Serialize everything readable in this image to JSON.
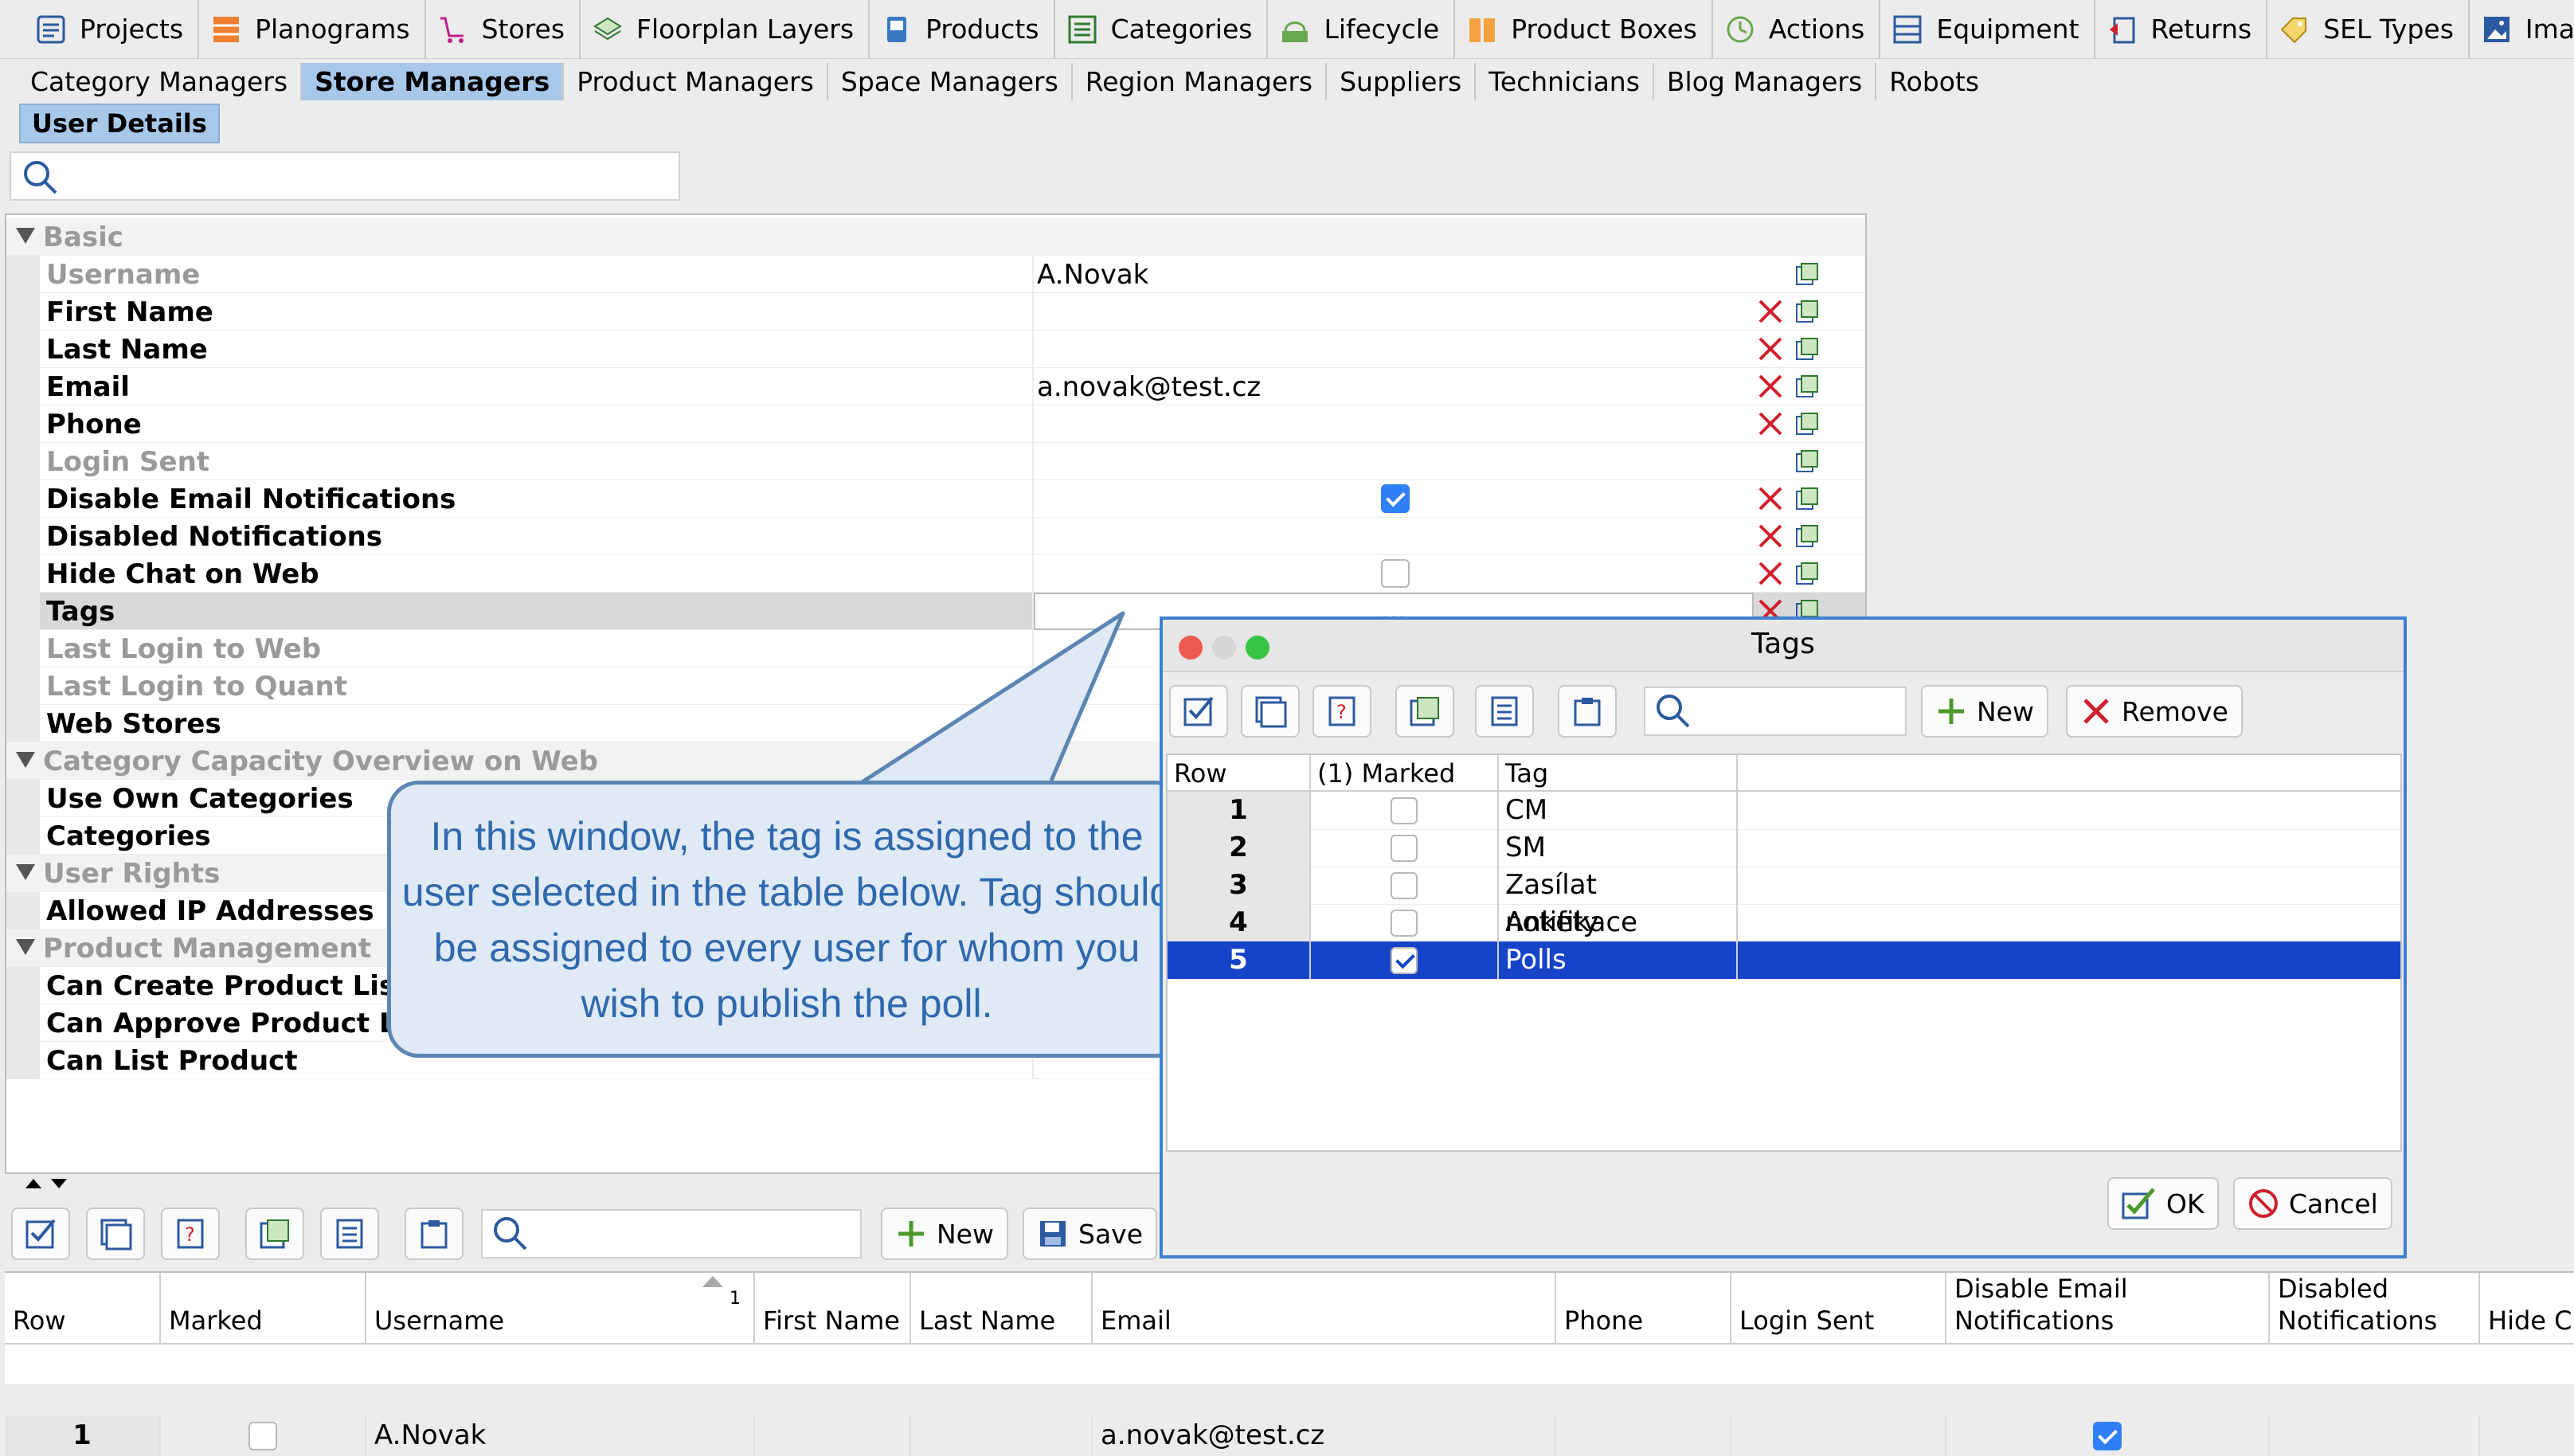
{
  "topnav": [
    {
      "label": "Projects",
      "icon": "projects-icon"
    },
    {
      "label": "Planograms",
      "icon": "planograms-icon"
    },
    {
      "label": "Stores",
      "icon": "cart-icon"
    },
    {
      "label": "Floorplan Layers",
      "icon": "layers-icon"
    },
    {
      "label": "Products",
      "icon": "products-icon"
    },
    {
      "label": "Categories",
      "icon": "categories-icon"
    },
    {
      "label": "Lifecycle",
      "icon": "lifecycle-icon"
    },
    {
      "label": "Product Boxes",
      "icon": "boxes-icon"
    },
    {
      "label": "Actions",
      "icon": "clock-icon"
    },
    {
      "label": "Equipment",
      "icon": "equipment-icon"
    },
    {
      "label": "Returns",
      "icon": "returns-icon"
    },
    {
      "label": "SEL Types",
      "icon": "tag-icon"
    },
    {
      "label": "Images",
      "icon": "image-icon"
    }
  ],
  "subnav": [
    "Category Managers",
    "Store Managers",
    "Product Managers",
    "Space Managers",
    "Region Managers",
    "Suppliers",
    "Technicians",
    "Blog Managers",
    "Robots"
  ],
  "active_subnav": "Store Managers",
  "tab": "User Details",
  "properties": [
    {
      "label": "Basic",
      "section": true
    },
    {
      "label": "Username",
      "gray": true,
      "value": "A.Novak"
    },
    {
      "label": "First Name",
      "value": ""
    },
    {
      "label": "Last Name",
      "value": ""
    },
    {
      "label": "Email",
      "value": "a.novak@test.cz"
    },
    {
      "label": "Phone",
      "value": ""
    },
    {
      "label": "Login Sent",
      "gray": true,
      "value": ""
    },
    {
      "label": "Disable Email Notifications",
      "checkbox": true,
      "checked": true
    },
    {
      "label": "Disabled Notifications",
      "value": ""
    },
    {
      "label": "Hide Chat on Web",
      "checkbox": true,
      "checked": false
    },
    {
      "label": "Tags",
      "value": "...",
      "selected": true
    },
    {
      "label": "Last Login to Web",
      "gray": true,
      "value": ""
    },
    {
      "label": "Last Login to Quant",
      "gray": true,
      "value": ""
    },
    {
      "label": "Web Stores",
      "value": ""
    },
    {
      "label": "Category Capacity Overview on Web",
      "section": true
    },
    {
      "label": "Use Own Categories",
      "value": ""
    },
    {
      "label": "Categories",
      "value": ""
    },
    {
      "label": "User Rights",
      "section": true
    },
    {
      "label": "Allowed IP Addresses",
      "value": ""
    },
    {
      "label": "Product Management",
      "section": true
    },
    {
      "label": "Can Create Product List",
      "value": ""
    },
    {
      "label": "Can Approve Product Li",
      "value": ""
    },
    {
      "label": "Can List Product",
      "value": ""
    }
  ],
  "toolbar": {
    "new_label": "New",
    "save_label": "Save"
  },
  "table": {
    "columns": [
      "Row",
      "Marked",
      "Username",
      "First Name",
      "Last Name",
      "Email",
      "Phone",
      "Login Sent",
      "Disable Email Notifications",
      "Disabled Notifications",
      "Hide Cl"
    ],
    "sort_index": "1",
    "rows": [
      {
        "row": "1",
        "username": "A.Novak",
        "email": "a.novak@test.cz",
        "marked": false,
        "disable_email": true
      }
    ]
  },
  "callout": "In this window, the tag is assigned to the user selected in the table below. Tag should be assigned to every user for whom you wish to publish the poll.",
  "dialog": {
    "title": "Tags",
    "new_label": "New",
    "remove_label": "Remove",
    "columns": [
      "Row",
      "(1) Marked",
      "Tag"
    ],
    "rows": [
      {
        "row": "1",
        "tag": "CM",
        "marked": false
      },
      {
        "row": "2",
        "tag": "SM",
        "marked": false
      },
      {
        "row": "3",
        "tag": "Zasílat notifikace",
        "marked": false
      },
      {
        "row": "4",
        "tag": "Ankety",
        "marked": false
      },
      {
        "row": "5",
        "tag": "Polls",
        "marked": true,
        "selected": true
      }
    ],
    "ok_label": "OK",
    "cancel_label": "Cancel"
  },
  "colors": {
    "accent": "#1544c8",
    "active_tab": "#a8c8ea",
    "callout_text": "#2f68ad",
    "delete": "#d0202c"
  }
}
